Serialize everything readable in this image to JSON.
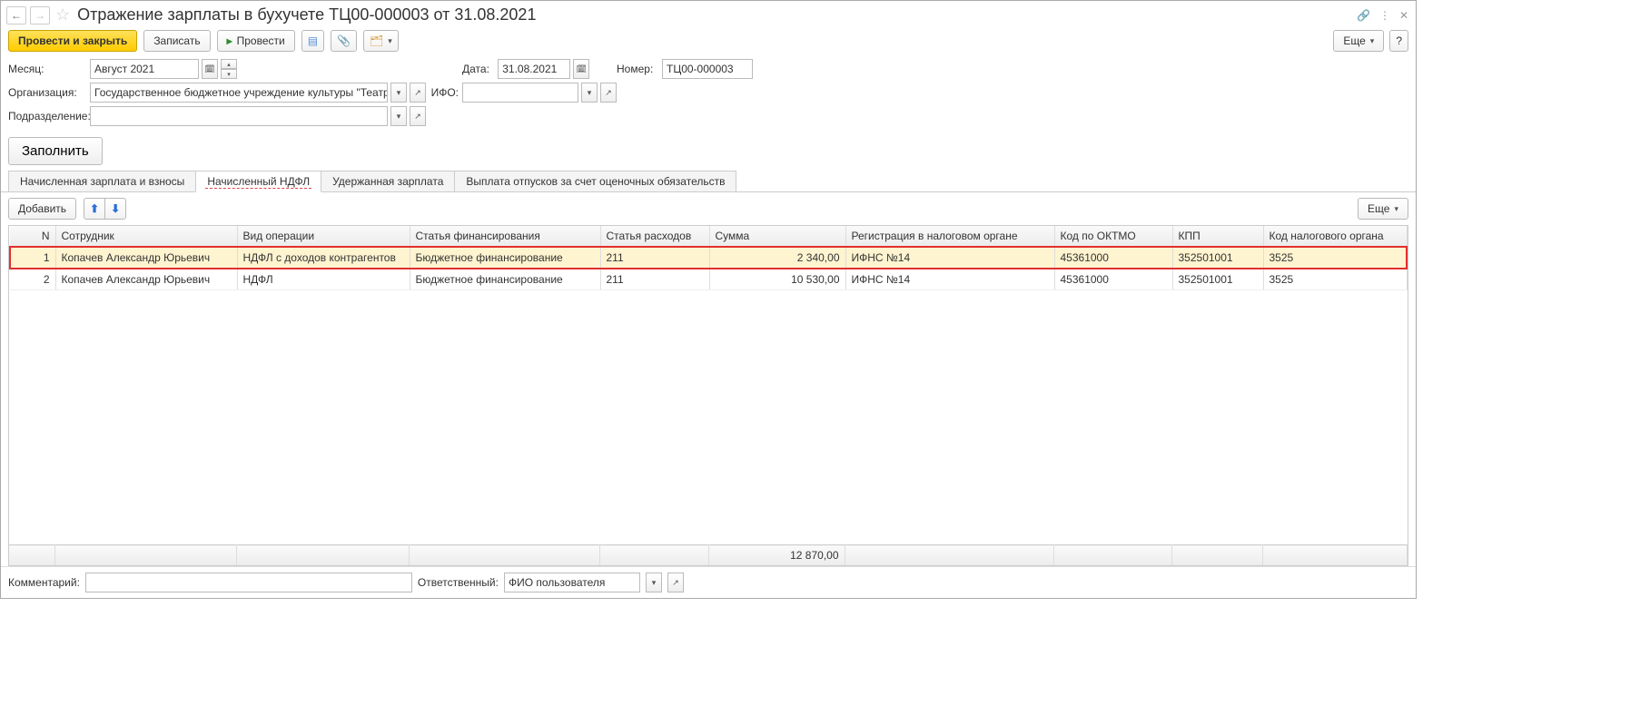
{
  "title": "Отражение зарплаты в бухучете ТЦ00-000003 от 31.08.2021",
  "toolbar": {
    "post_close": "Провести и закрыть",
    "save": "Записать",
    "post": "Провести",
    "more": "Еще",
    "help": "?"
  },
  "form": {
    "month_lbl": "Месяц:",
    "month_val": "Август 2021",
    "date_lbl": "Дата:",
    "date_val": "31.08.2021",
    "number_lbl": "Номер:",
    "number_val": "ТЦ00-000003",
    "org_lbl": "Организация:",
    "org_val": "Государственное бюджетное учреждение культуры \"Театраг",
    "ifo_lbl": "ИФО:",
    "ifo_val": "",
    "dept_lbl": "Подразделение:",
    "dept_val": ""
  },
  "fill_btn": "Заполнить",
  "tabs": {
    "t1": "Начисленная зарплата и взносы",
    "t2": "Начисленный НДФЛ",
    "t3": "Удержанная зарплата",
    "t4": "Выплата отпусков за счет оценочных обязательств"
  },
  "tab_toolbar": {
    "add": "Добавить",
    "more": "Еще"
  },
  "table": {
    "headers": {
      "n": "N",
      "emp": "Сотрудник",
      "op": "Вид операции",
      "fin": "Статья финансирования",
      "exp": "Статья расходов",
      "sum": "Сумма",
      "reg": "Регистрация в налоговом органе",
      "okt": "Код по ОКТМО",
      "kpp": "КПП",
      "tax": "Код налогового органа"
    },
    "rows": [
      {
        "n": "1",
        "emp": "Копачев Александр Юрьевич",
        "op": "НДФЛ с доходов контрагентов",
        "fin": "Бюджетное финансирование",
        "exp": "211",
        "sum": "2 340,00",
        "reg": "ИФНС №14",
        "okt": "45361000",
        "kpp": "352501001",
        "tax": "3525",
        "hl": true
      },
      {
        "n": "2",
        "emp": "Копачев Александр Юрьевич",
        "op": "НДФЛ",
        "fin": "Бюджетное финансирование",
        "exp": "211",
        "sum": "10 530,00",
        "reg": "ИФНС №14",
        "okt": "45361000",
        "kpp": "352501001",
        "tax": "3525",
        "hl": false
      }
    ],
    "total_sum": "12 870,00"
  },
  "footer": {
    "comment_lbl": "Комментарий:",
    "comment_val": "",
    "resp_lbl": "Ответственный:",
    "resp_val": "ФИО пользователя"
  }
}
